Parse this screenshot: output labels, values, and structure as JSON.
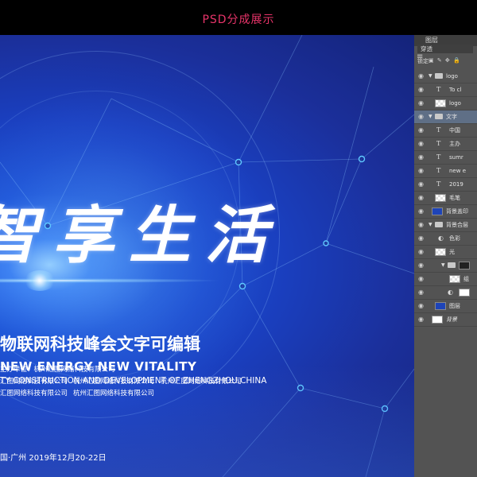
{
  "top_bar": {
    "title": "PSD分成展示"
  },
  "canvas": {
    "headline": "智享生活",
    "subtitle_cn": "物联网科技峰会文字可编辑",
    "subtitle_en_main": "NEW ENERGY  NEW VITALITY",
    "subtitle_en_sub": "TY CONSTRUCTION AND DEVELOPMENT OF ZHENGZHOU,CHINA",
    "host_line": "主办单位：杭州汇图网络科技有限公司",
    "org_lines": [
      "汇图网络科技有限公司",
      "杭州汇图网络科技有限公司",
      "杭州汇图网络科技有限公司",
      "汇图网络科技有限公司",
      "杭州汇图网络科技有限公司"
    ],
    "dateline": "国·广州    2019年12月20-22日",
    "colors": {
      "bg_dark": "#14237a",
      "bg_mid": "#1d55d6",
      "glow": "#9fd6ff",
      "node": "#5fc8ff"
    }
  },
  "layers_panel": {
    "tab_label": "图层",
    "blend_mode": "穿透",
    "lock_label": "锁定:",
    "layers": [
      {
        "name": "logo",
        "type": "group",
        "expanded": true,
        "selected": false
      },
      {
        "name": "To cl",
        "type": "text",
        "selected": false
      },
      {
        "name": "logo",
        "type": "image",
        "thumb": "checker",
        "selected": false
      },
      {
        "name": "文字",
        "type": "group",
        "expanded": true,
        "selected": true
      },
      {
        "name": "中国",
        "type": "text",
        "selected": false
      },
      {
        "name": "主办",
        "type": "text",
        "selected": false
      },
      {
        "name": "sumr",
        "type": "text",
        "selected": false
      },
      {
        "name": "new e",
        "type": "text",
        "selected": false
      },
      {
        "name": "2019",
        "type": "text",
        "selected": false
      },
      {
        "name": "毛笔",
        "type": "image",
        "thumb": "checker",
        "selected": false
      },
      {
        "name": "背景盖印",
        "type": "image",
        "thumb": "blue",
        "selected": false
      },
      {
        "name": "背景合层",
        "type": "group",
        "expanded": true,
        "selected": false
      },
      {
        "name": "色彩",
        "type": "adjust",
        "selected": false
      },
      {
        "name": "光",
        "type": "image",
        "thumb": "checker",
        "selected": false
      },
      {
        "name": "",
        "type": "group-mask",
        "selected": false
      },
      {
        "name": "组",
        "type": "image",
        "thumb": "checker",
        "selected": false
      },
      {
        "name": "",
        "type": "adjust-white",
        "selected": false
      },
      {
        "name": "图层",
        "type": "image",
        "thumb": "blue",
        "selected": false
      },
      {
        "name": "背景",
        "type": "image",
        "thumb": "white",
        "selected": false
      }
    ]
  }
}
